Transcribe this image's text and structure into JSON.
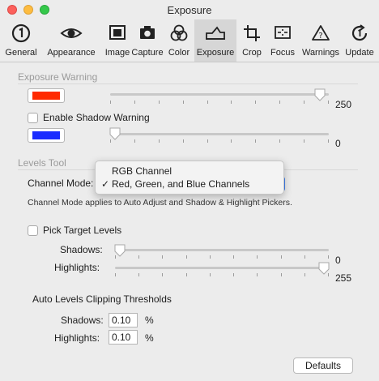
{
  "window": {
    "title": "Exposure"
  },
  "toolbar": {
    "items": [
      {
        "label": "General",
        "icon": "number-one-circle-icon"
      },
      {
        "label": "Appearance",
        "icon": "eye-icon"
      },
      {
        "label": "Image",
        "icon": "image-icon"
      },
      {
        "label": "Capture",
        "icon": "camera-icon"
      },
      {
        "label": "Color",
        "icon": "color-circles-icon"
      },
      {
        "label": "Exposure",
        "icon": "exposure-curve-icon"
      },
      {
        "label": "Crop",
        "icon": "crop-icon"
      },
      {
        "label": "Focus",
        "icon": "focus-icon"
      },
      {
        "label": "Warnings",
        "icon": "warning-icon"
      },
      {
        "label": "Update",
        "icon": "update-icon"
      }
    ],
    "selected": "Exposure"
  },
  "exposure_warning": {
    "heading": "Exposure Warning",
    "highlight_color": "#ff2a00",
    "highlight_value": "250",
    "highlight_level": 250,
    "shadow_checkbox_label": "Enable Shadow Warning",
    "shadow_checked": false,
    "shadow_color": "#1a2cff",
    "shadow_value": "0",
    "shadow_level": 0
  },
  "levels_tool": {
    "heading": "Levels Tool",
    "channel_mode_label": "Channel Mode:",
    "menu_options": [
      "RGB Channel",
      "Red, Green, and Blue Channels"
    ],
    "menu_checkmark": "✓",
    "selected_option": "Red, Green, and Blue Channels",
    "note": "Channel Mode applies to Auto Adjust and Shadow & Highlight Pickers.",
    "pick_target_label": "Pick Target Levels",
    "pick_target_checked": false,
    "shadows_label": "Shadows:",
    "shadows_value": "0",
    "shadows_level": 0,
    "highlights_label": "Highlights:",
    "highlights_value": "255",
    "highlights_level": 255
  },
  "auto_levels": {
    "heading": "Auto Levels Clipping Thresholds",
    "shadows_label": "Shadows:",
    "shadows_value": "0.10",
    "highlights_label": "Highlights:",
    "highlights_value": "0.10",
    "percent": "%"
  },
  "defaults_button": "Defaults",
  "colors": {
    "accent": "#3d7ef0"
  }
}
